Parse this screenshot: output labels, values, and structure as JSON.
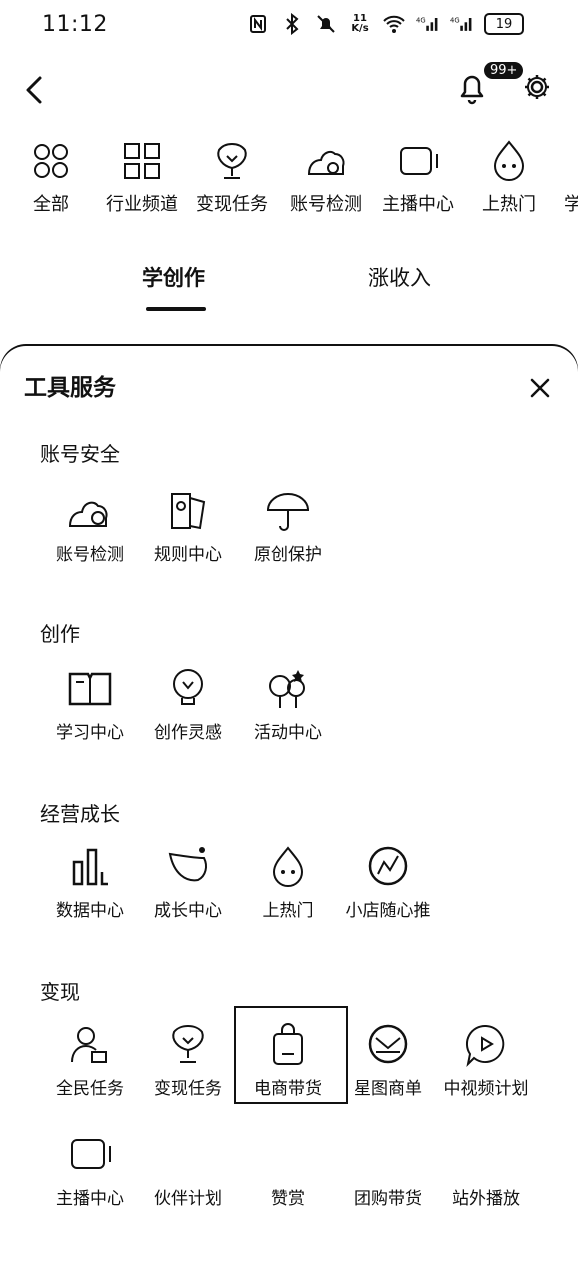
{
  "status_bar": {
    "time": "11:12",
    "network_speed": "11\nK/s",
    "battery_level": "19"
  },
  "header": {
    "notification_badge": "99+"
  },
  "quick_nav": [
    {
      "label": "全部",
      "icon": "all-grid-icon"
    },
    {
      "label": "行业频道",
      "icon": "industry-channel-icon"
    },
    {
      "label": "变现任务",
      "icon": "monetize-task-icon"
    },
    {
      "label": "账号检测",
      "icon": "account-check-icon"
    },
    {
      "label": "主播中心",
      "icon": "anchor-center-icon"
    },
    {
      "label": "上热门",
      "icon": "trending-icon"
    },
    {
      "label": "学",
      "icon": ""
    }
  ],
  "tabs": [
    {
      "label": "学创作",
      "active": true
    },
    {
      "label": "涨收入",
      "active": false
    }
  ],
  "sheet": {
    "title": "工具服务",
    "sections": [
      {
        "title": "账号安全",
        "items": [
          {
            "label": "账号检测",
            "icon": "account-check-icon"
          },
          {
            "label": "规则中心",
            "icon": "rules-center-icon"
          },
          {
            "label": "原创保护",
            "icon": "original-protection-icon"
          }
        ]
      },
      {
        "title": "创作",
        "items": [
          {
            "label": "学习中心",
            "icon": "learning-center-icon"
          },
          {
            "label": "创作灵感",
            "icon": "inspiration-bulb-icon"
          },
          {
            "label": "活动中心",
            "icon": "activity-center-icon"
          }
        ]
      },
      {
        "title": "经营成长",
        "items": [
          {
            "label": "数据中心",
            "icon": "data-center-icon"
          },
          {
            "label": "成长中心",
            "icon": "growth-center-icon"
          },
          {
            "label": "上热门",
            "icon": "trending-icon"
          },
          {
            "label": "小店随心推",
            "icon": "shop-promote-icon"
          }
        ]
      },
      {
        "title": "变现",
        "items": [
          {
            "label": "全民任务",
            "icon": "public-task-icon"
          },
          {
            "label": "变现任务",
            "icon": "monetize-task-icon"
          },
          {
            "label": "电商带货",
            "icon": "ecommerce-bag-icon"
          },
          {
            "label": "星图商单",
            "icon": "star-map-icon"
          },
          {
            "label": "中视频计划",
            "icon": "mid-video-icon"
          },
          {
            "label": "主播中心",
            "icon": "anchor-center-icon"
          },
          {
            "label": "伙伴计划",
            "icon": ""
          },
          {
            "label": "赞赏",
            "icon": ""
          },
          {
            "label": "团购带货",
            "icon": ""
          },
          {
            "label": "站外播放",
            "icon": ""
          }
        ]
      }
    ]
  }
}
